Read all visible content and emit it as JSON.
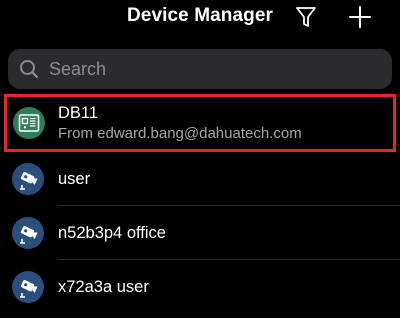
{
  "header": {
    "title": "Device Manager",
    "filter_icon": "filter-icon",
    "add_icon": "plus-icon"
  },
  "search": {
    "placeholder": "Search",
    "value": ""
  },
  "devices": [
    {
      "name": "DB11",
      "subtitle": "From edward.bang@dahuatech.com",
      "icon": "doorbell-device-icon",
      "highlighted": true
    },
    {
      "name": "user",
      "subtitle": "",
      "icon": "camera-icon",
      "highlighted": false
    },
    {
      "name": "n52b3p4 office",
      "subtitle": "",
      "icon": "camera-icon",
      "highlighted": false
    },
    {
      "name": "x72a3a user",
      "subtitle": "",
      "icon": "camera-icon",
      "highlighted": false
    }
  ],
  "colors": {
    "background": "#000000",
    "search_bg": "#2b2b2e",
    "highlight_border": "#e3282b",
    "shared_device_icon_bg": "#2e7d5b",
    "camera_icon_bg": "#2a4f7c"
  }
}
